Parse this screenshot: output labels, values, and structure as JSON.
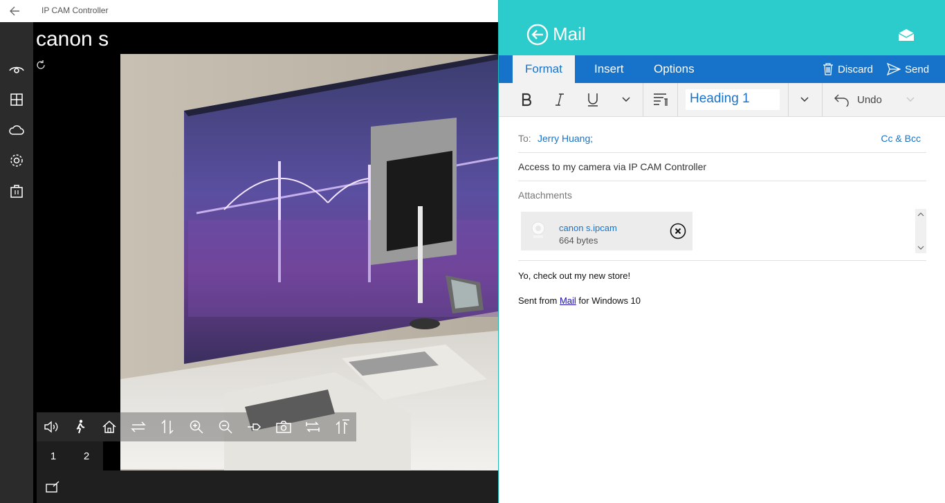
{
  "app": {
    "title": "IP CAM Controller",
    "camera_name": "canon s",
    "sidebar_icons": [
      "eye-icon",
      "grid-icon",
      "cloud-icon",
      "gear-icon",
      "store-icon"
    ],
    "ptz_icons": [
      "volume-icon",
      "motion-icon",
      "home-icon",
      "swap-horizontal-icon",
      "swap-vertical-icon",
      "zoom-in-icon",
      "zoom-out-icon",
      "pin-icon",
      "camera-icon",
      "flip-horizontal-icon",
      "flip-vertical-icon"
    ],
    "presets": [
      "1",
      "2"
    ]
  },
  "mail": {
    "title": "Mail",
    "tabs": [
      "Format",
      "Insert",
      "Options"
    ],
    "active_tab": "Format",
    "discard_label": "Discard",
    "send_label": "Send",
    "style_value": "Heading 1",
    "undo_label": "Undo",
    "to_label": "To:",
    "to_value": "Jerry Huang;",
    "ccbcc_label": "Cc & Bcc",
    "subject": "Access to my camera via IP CAM Controller",
    "attachments_label": "Attachments",
    "attachment": {
      "name": "canon s.ipcam",
      "size": "664 bytes"
    },
    "body_line1": "Yo, check out my new store!",
    "body_sent_prefix": "Sent from ",
    "body_link": "Mail",
    "body_sent_suffix": " for Windows 10"
  },
  "colors": {
    "mail_header": "#2ccbcc",
    "ribbon": "#1773c9",
    "link": "#1773c9"
  }
}
